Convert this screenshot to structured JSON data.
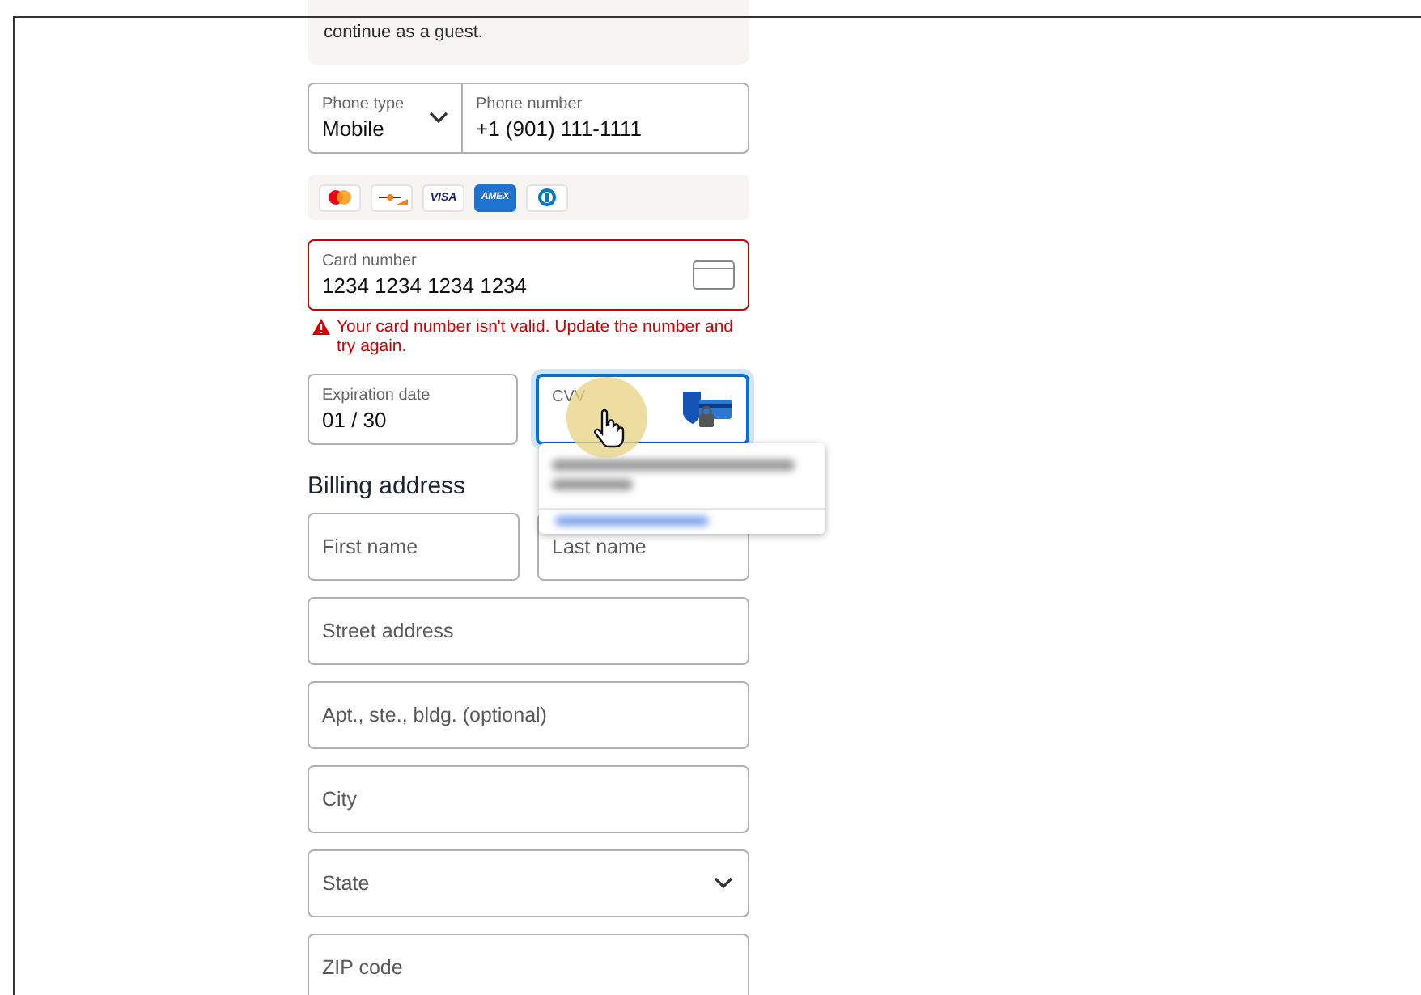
{
  "notice": {
    "text": "continue as a guest."
  },
  "phone": {
    "type_label": "Phone type",
    "type_value": "Mobile",
    "number_label": "Phone number",
    "number_value": "+1  (901) 111-1111"
  },
  "card_brands": [
    {
      "kind": "mastercard"
    },
    {
      "kind": "discover"
    },
    {
      "kind": "visa",
      "text": "VISA"
    },
    {
      "kind": "amex",
      "text": "AMEX"
    },
    {
      "kind": "diners"
    }
  ],
  "card_number": {
    "label": "Card number",
    "value": "1234 1234 1234 1234",
    "invalid": true,
    "error": "Your card number isn't valid. Update the number and try again."
  },
  "expiration": {
    "label": "Expiration date",
    "value": "01 / 30"
  },
  "cvv": {
    "label": "CVV",
    "focused": true
  },
  "billing": {
    "heading": "Billing address",
    "rows": [
      [
        {
          "placeholder": "First name",
          "kind": "text"
        },
        {
          "placeholder": "Last name",
          "kind": "text"
        }
      ],
      [
        {
          "placeholder": "Street address",
          "kind": "text"
        }
      ],
      [
        {
          "placeholder": "Apt., ste., bldg. (optional)",
          "kind": "text"
        }
      ],
      [
        {
          "placeholder": "City",
          "kind": "text"
        }
      ],
      [
        {
          "placeholder": "State",
          "kind": "select"
        }
      ],
      [
        {
          "placeholder": "ZIP code",
          "kind": "text"
        }
      ]
    ]
  }
}
